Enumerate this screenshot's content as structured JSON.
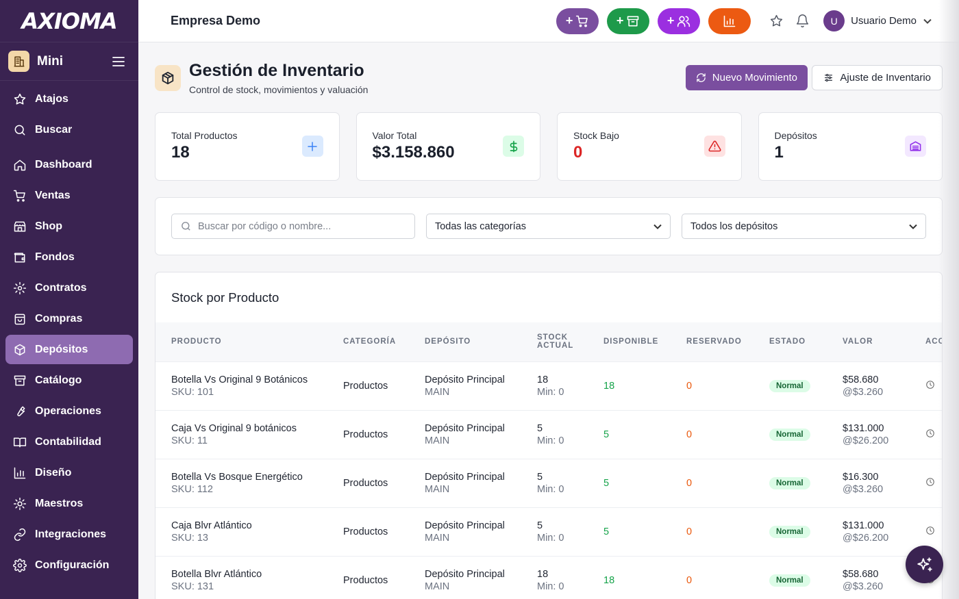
{
  "brand": {
    "logo": "AXIOMA"
  },
  "sidebar": {
    "mode_label": "Mini",
    "items": [
      {
        "label": "Atajos",
        "icon": "star-icon"
      },
      {
        "label": "Buscar",
        "icon": "search-icon"
      },
      {
        "label": "Dashboard",
        "icon": "home-icon"
      },
      {
        "label": "Ventas",
        "icon": "cart-icon"
      },
      {
        "label": "Shop",
        "icon": "store-icon"
      },
      {
        "label": "Fondos",
        "icon": "wallet-icon"
      },
      {
        "label": "Contratos",
        "icon": "gear-icon"
      },
      {
        "label": "Compras",
        "icon": "bag-icon"
      },
      {
        "label": "Depósitos",
        "icon": "package-icon"
      },
      {
        "label": "Catálogo",
        "icon": "archive-icon"
      },
      {
        "label": "Operaciones",
        "icon": "wrench-icon"
      },
      {
        "label": "Contabilidad",
        "icon": "book-icon"
      },
      {
        "label": "Diseño",
        "icon": "bar-chart-icon"
      },
      {
        "label": "Maestros",
        "icon": "cog-icon"
      },
      {
        "label": "Integraciones",
        "icon": "link-icon"
      },
      {
        "label": "Configuración",
        "icon": "settings-icon"
      }
    ],
    "active": "Depósitos"
  },
  "topbar": {
    "company": "Empresa Demo",
    "quick_actions": [
      "+",
      "+",
      "+"
    ],
    "user": {
      "initial": "U",
      "name": "Usuario Demo"
    }
  },
  "page": {
    "title": "Gestión de Inventario",
    "subtitle": "Control de stock, movimientos y valuación",
    "primary_button": "Nuevo Movimiento",
    "secondary_button": "Ajuste de Inventario"
  },
  "stats": [
    {
      "label": "Total Productos",
      "value": "18",
      "color": "#3b82f6"
    },
    {
      "label": "Valor Total",
      "value": "$3.158.860",
      "color": "#16a34a"
    },
    {
      "label": "Stock Bajo",
      "value": "0",
      "color": "#dc2626"
    },
    {
      "label": "Depósitos",
      "value": "1",
      "color": "#9333ea"
    }
  ],
  "filters": {
    "search_placeholder": "Buscar por código o nombre...",
    "category": "Todas las categorías",
    "warehouse": "Todos los depósitos"
  },
  "table": {
    "title": "Stock por Producto",
    "headers": [
      "Producto",
      "Categoría",
      "Depósito",
      "Stock Actual",
      "Disponible",
      "Reservado",
      "Estado",
      "Valor",
      "Acc"
    ],
    "rows": [
      {
        "name": "Botella Vs Original 9 Botánicos",
        "sku": "SKU: 101",
        "category": "Productos",
        "warehouse": "Depósito Principal",
        "warehouse_code": "MAIN",
        "stock": "18",
        "min": "Min: 0",
        "available": "18",
        "reserved": "0",
        "status": "Normal",
        "value": "$58.680",
        "unit": "@$3.260"
      },
      {
        "name": "Caja Vs Original 9 botánicos",
        "sku": "SKU: 11",
        "category": "Productos",
        "warehouse": "Depósito Principal",
        "warehouse_code": "MAIN",
        "stock": "5",
        "min": "Min: 0",
        "available": "5",
        "reserved": "0",
        "status": "Normal",
        "value": "$131.000",
        "unit": "@$26.200"
      },
      {
        "name": "Botella Vs Bosque Energético",
        "sku": "SKU: 112",
        "category": "Productos",
        "warehouse": "Depósito Principal",
        "warehouse_code": "MAIN",
        "stock": "5",
        "min": "Min: 0",
        "available": "5",
        "reserved": "0",
        "status": "Normal",
        "value": "$16.300",
        "unit": "@$3.260"
      },
      {
        "name": "Caja Blvr Atlántico",
        "sku": "SKU: 13",
        "category": "Productos",
        "warehouse": "Depósito Principal",
        "warehouse_code": "MAIN",
        "stock": "5",
        "min": "Min: 0",
        "available": "5",
        "reserved": "0",
        "status": "Normal",
        "value": "$131.000",
        "unit": "@$26.200"
      },
      {
        "name": "Botella Blvr Atlántico",
        "sku": "SKU: 131",
        "category": "Productos",
        "warehouse": "Depósito Principal",
        "warehouse_code": "MAIN",
        "stock": "18",
        "min": "Min: 0",
        "available": "18",
        "reserved": "0",
        "status": "Normal",
        "value": "$58.680",
        "unit": "@$3.260"
      }
    ]
  }
}
